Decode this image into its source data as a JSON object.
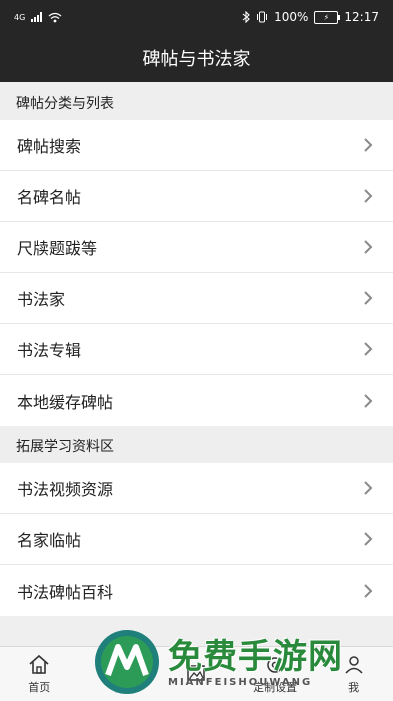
{
  "status_bar": {
    "network": "4G",
    "battery": "100%",
    "battery_level": 100,
    "time": "12:17",
    "icons": [
      "signal-icon",
      "wifi-icon",
      "bluetooth-icon",
      "vibrate-icon",
      "battery-icon"
    ]
  },
  "header": {
    "title": "碑帖与书法家"
  },
  "sections": [
    {
      "title": "碑帖分类与列表",
      "items": [
        "碑帖搜索",
        "名碑名帖",
        "尺牍题跋等",
        "书法家",
        "书法专辑",
        "本地缓存碑帖"
      ]
    },
    {
      "title": "拓展学习资料区",
      "items": [
        "书法视频资源",
        "名家临帖",
        "书法碑帖百科"
      ]
    }
  ],
  "tab_bar": {
    "tabs": [
      {
        "label": "首页",
        "icon": "home-icon"
      },
      {
        "label": "学",
        "icon": "book-icon"
      },
      {
        "label": "",
        "icon": "image-icon"
      },
      {
        "label": "定制设置",
        "icon": "settings-icon"
      },
      {
        "label": "我",
        "icon": "user-icon"
      }
    ]
  },
  "watermark": {
    "main": "免费手游网",
    "sub": "MIANFEISHOUWANG",
    "color": "#2a8a3c"
  }
}
